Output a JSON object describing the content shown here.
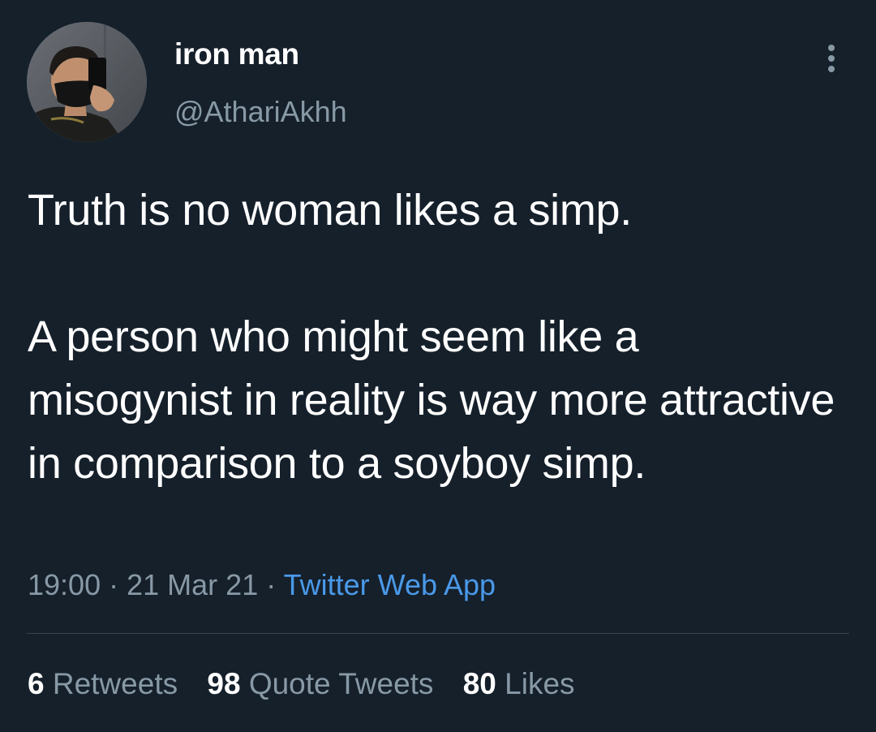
{
  "author": {
    "display_name": "iron man",
    "handle": "@AthariAkhh",
    "avatar_icon": "profile-photo"
  },
  "tweet": {
    "paragraphs": [
      "Truth is no woman likes a simp.",
      "A person who might seem like a misogynist in reality is way more attractive in comparison to a soyboy simp."
    ],
    "time": "19:00",
    "separator": "·",
    "date": "21 Mar 21",
    "source": "Twitter Web App"
  },
  "stats": {
    "retweets_count": "6",
    "retweets_label": "Retweets",
    "quotes_count": "98",
    "quotes_label": "Quote Tweets",
    "likes_count": "80",
    "likes_label": "Likes"
  },
  "colors": {
    "background": "#15202b",
    "primary_text": "#ffffff",
    "secondary_text": "#8899a6",
    "link": "#4a99e9",
    "divider": "#38444d"
  },
  "icons": {
    "more": "vertical-ellipsis-icon"
  }
}
